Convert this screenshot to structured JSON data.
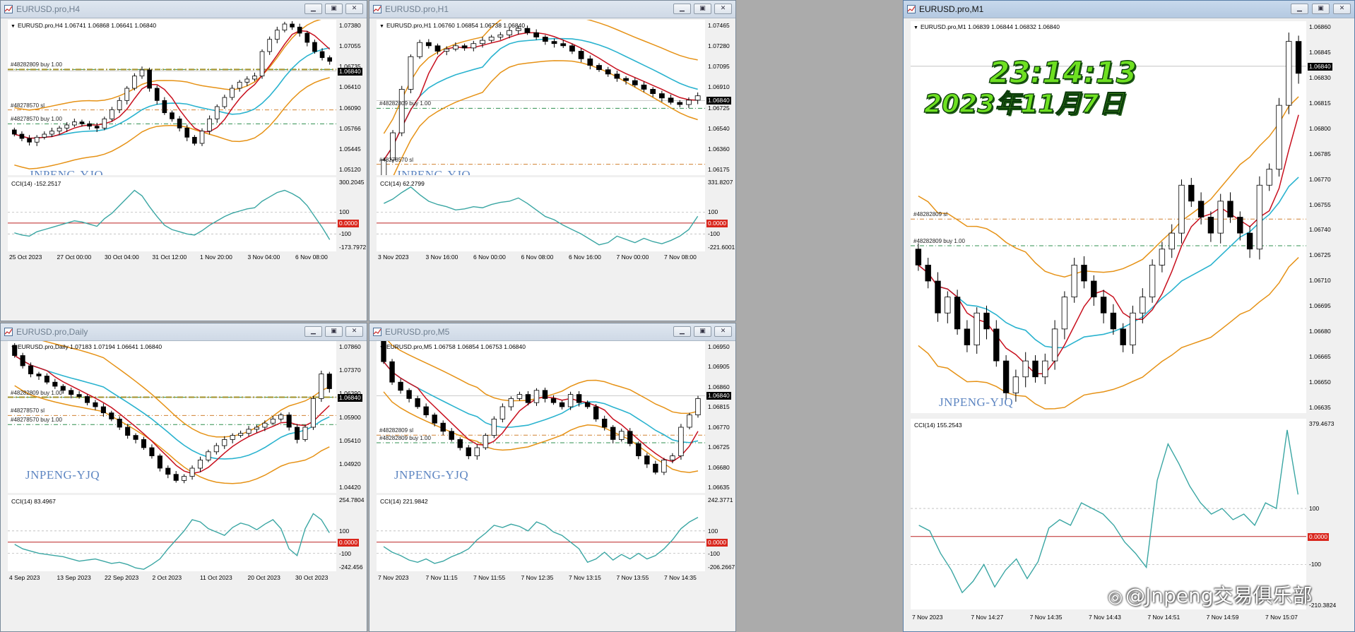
{
  "watermark": "JNPENG-YJQ",
  "colors": {
    "up": "#ffffff",
    "down": "#000000",
    "red_line": "#c8101e",
    "blue_line": "#2ab3cf",
    "band": "#e69216",
    "teal_cci": "#3aa6a3",
    "sl": "#d08030",
    "buy": "#2f8f4f",
    "orders": "#a09028"
  },
  "windows": [
    {
      "id": "h4",
      "title": "EURUSD.pro,H4",
      "active": false,
      "header": "EURUSD.pro,H4  1.06741 1.06868 1.06641 1.06840",
      "price_labels": [
        "1.07380",
        "1.07055",
        "1.06735",
        "1.06410",
        "1.06090",
        "1.05766",
        "1.05445",
        "1.05120"
      ],
      "current_price": "1.06840",
      "orders": [
        "#48282809 buy 1.00",
        "#48278570 sl",
        "#48278570 buy 1.00"
      ],
      "cci_label": "CCI(14) -152.2517",
      "cci_labels": [
        "300.2045",
        "100",
        "-100",
        "-173.7972"
      ],
      "cci_zero": "0.0000",
      "time_labels": [
        "25 Oct 2023",
        "27 Oct 00:00",
        "30 Oct 04:00",
        "31 Oct 12:00",
        "1 Nov 20:00",
        "3 Nov 04:00",
        "6 Nov 08:00"
      ]
    },
    {
      "id": "h1",
      "title": "EURUSD.pro,H1",
      "active": false,
      "header": "EURUSD.pro,H1  1.06760 1.06854 1.06738 1.06840",
      "price_labels": [
        "1.07465",
        "1.07280",
        "1.07095",
        "1.06910",
        "1.06725",
        "1.06540",
        "1.06360",
        "1.06175"
      ],
      "current_price": "1.06840",
      "orders": [
        "#48282809 buy 1.00",
        "#48278570 sl"
      ],
      "cci_label": "CCI(14) 62.2799",
      "cci_labels": [
        "331.8207",
        "100",
        "-100",
        "-221.6001"
      ],
      "cci_zero": "0.0000",
      "time_labels": [
        "3 Nov 2023",
        "3 Nov 16:00",
        "6 Nov 00:00",
        "6 Nov 08:00",
        "6 Nov 16:00",
        "7 Nov 00:00",
        "7 Nov 08:00"
      ]
    },
    {
      "id": "d1",
      "title": "EURUSD.pro,Daily",
      "active": false,
      "header": "EURUSD.pro,Daily  1.07183 1.07194 1.06641 1.06840",
      "price_labels": [
        "1.07860",
        "1.07370",
        "1.06390",
        "1.05900",
        "1.05410",
        "1.04920",
        "1.04420"
      ],
      "current_price": "1.06840",
      "orders": [
        "#48282809 buy 1.00",
        "#48278570 sl",
        "#48278570 buy 1.00"
      ],
      "cci_label": "CCI(14) 83.4967",
      "cci_labels": [
        "254.7804",
        "100",
        "-100",
        "-242.456"
      ],
      "cci_zero": "0.0000",
      "time_labels": [
        "4 Sep 2023",
        "13 Sep 2023",
        "22 Sep 2023",
        "2 Oct 2023",
        "11 Oct 2023",
        "20 Oct 2023",
        "30 Oct 2023"
      ]
    },
    {
      "id": "m5",
      "title": "EURUSD.pro,M5",
      "active": false,
      "header": "EURUSD.pro,M5  1.06758 1.06854 1.06753 1.06840",
      "price_labels": [
        "1.06950",
        "1.06905",
        "1.06860",
        "1.06815",
        "1.06770",
        "1.06725",
        "1.06680",
        "1.06635"
      ],
      "current_price": "1.06840",
      "orders": [
        "#48282809 sl",
        "#48282809 buy 1.00"
      ],
      "cci_label": "CCI(14) 221.9842",
      "cci_labels": [
        "242.3771",
        "100",
        "-100",
        "-206.2667"
      ],
      "cci_zero": "0.0000",
      "time_labels": [
        "7 Nov 2023",
        "7 Nov 11:15",
        "7 Nov 11:55",
        "7 Nov 12:35",
        "7 Nov 13:15",
        "7 Nov 13:55",
        "7 Nov 14:35"
      ]
    },
    {
      "id": "m1",
      "title": "EURUSD.pro,M1",
      "active": true,
      "header": "EURUSD.pro,M1  1.06839 1.06844 1.06832 1.06840",
      "price_labels": [
        "1.06860",
        "1.06845",
        "1.06830",
        "1.06815",
        "1.06800",
        "1.06785",
        "1.06770",
        "1.06755",
        "1.06740",
        "1.06725",
        "1.06710",
        "1.06695",
        "1.06680",
        "1.06665",
        "1.06650",
        "1.06635"
      ],
      "current_price": "1.06840",
      "orders": [
        "#48282809 sl",
        "#48282809 buy 1.00"
      ],
      "cci_label": "CCI(14) 155.2543",
      "cci_labels": [
        "379.4673",
        "100",
        "-100",
        "-210.3824"
      ],
      "cci_zero": "0.0000",
      "time_labels": [
        "7 Nov 2023",
        "7 Nov 14:27",
        "7 Nov 14:35",
        "7 Nov 14:43",
        "7 Nov 14:51",
        "7 Nov 14:59",
        "7 Nov 15:07"
      ]
    }
  ],
  "overlay": {
    "time": "23:14:13",
    "date": "2023年11月7日"
  },
  "brand_label": "@Jnpeng交易俱乐部",
  "brand_icon": "camera-icon",
  "window_buttons": {
    "minimize": "minimize-icon",
    "restore": "restore-icon",
    "close": "close-icon"
  },
  "chart_data": [
    {
      "type": "candlestick",
      "title": "EURUSD.pro,H4",
      "ylim": [
        1.0505,
        1.0745
      ],
      "close": [
        1.0565,
        1.0558,
        1.0552,
        1.056,
        1.0565,
        1.057,
        1.0575,
        1.058,
        1.0585,
        1.0582,
        1.0578,
        1.0575,
        1.059,
        1.0605,
        1.062,
        1.064,
        1.066,
        1.067,
        1.064,
        1.062,
        1.06,
        1.059,
        1.0575,
        1.056,
        1.055,
        1.057,
        1.059,
        1.061,
        1.0625,
        1.064,
        1.065,
        1.0655,
        1.066,
        1.07,
        1.072,
        1.0735,
        1.0745,
        1.074,
        1.073,
        1.0715,
        1.07,
        1.069,
        1.0684
      ],
      "cci": [
        -90,
        -110,
        -120,
        -80,
        -60,
        -40,
        -20,
        0,
        20,
        10,
        -10,
        -30,
        40,
        90,
        160,
        230,
        300,
        250,
        150,
        60,
        -20,
        -60,
        -80,
        -100,
        -110,
        -70,
        -20,
        20,
        60,
        90,
        110,
        130,
        140,
        200,
        240,
        280,
        300,
        270,
        230,
        160,
        60,
        -40,
        -152
      ]
    },
    {
      "type": "candlestick",
      "title": "EURUSD.pro,H1",
      "ylim": [
        1.0615,
        1.075
      ],
      "close": [
        1.0625,
        1.065,
        1.069,
        1.072,
        1.0733,
        1.073,
        1.0725,
        1.0727,
        1.073,
        1.0728,
        1.0732,
        1.0735,
        1.0738,
        1.074,
        1.0744,
        1.0746,
        1.0742,
        1.0738,
        1.0734,
        1.0732,
        1.073,
        1.0725,
        1.0718,
        1.0712,
        1.0708,
        1.0704,
        1.07,
        1.0698,
        1.0694,
        1.069,
        1.0686,
        1.0682,
        1.0678,
        1.0676,
        1.068,
        1.0684
      ],
      "cci": [
        180,
        220,
        280,
        331,
        260,
        200,
        170,
        150,
        120,
        130,
        150,
        140,
        170,
        190,
        200,
        230,
        180,
        120,
        60,
        30,
        -20,
        -60,
        -100,
        -150,
        -200,
        -180,
        -120,
        -150,
        -180,
        -140,
        -170,
        -190,
        -160,
        -120,
        -60,
        62
      ]
    },
    {
      "type": "candlestick",
      "title": "EURUSD.pro,Daily",
      "ylim": [
        1.044,
        1.079
      ],
      "close": [
        1.0765,
        1.074,
        1.072,
        1.0715,
        1.07,
        1.069,
        1.068,
        1.067,
        1.0665,
        1.065,
        1.064,
        1.0625,
        1.061,
        1.059,
        1.057,
        1.056,
        1.054,
        1.052,
        1.049,
        1.0475,
        1.046,
        1.047,
        1.049,
        1.051,
        1.053,
        1.0545,
        1.056,
        1.057,
        1.0575,
        1.0585,
        1.059,
        1.06,
        1.061,
        1.062,
        1.059,
        1.056,
        1.059,
        1.066,
        1.072,
        1.0684
      ],
      "cci": [
        -20,
        -60,
        -80,
        -100,
        -110,
        -120,
        -130,
        -150,
        -170,
        -160,
        -150,
        -170,
        -190,
        -180,
        -200,
        -230,
        -242,
        -200,
        -150,
        -60,
        20,
        100,
        200,
        180,
        120,
        90,
        60,
        130,
        170,
        150,
        110,
        160,
        200,
        120,
        -60,
        -120,
        120,
        254,
        200,
        83
      ]
    },
    {
      "type": "candlestick",
      "title": "EURUSD.pro,M5",
      "ylim": [
        1.0662,
        1.0697
      ],
      "close": [
        1.0693,
        1.0688,
        1.0686,
        1.0684,
        1.0682,
        1.068,
        1.0678,
        1.0676,
        1.0674,
        1.0672,
        1.067,
        1.0672,
        1.0675,
        1.0679,
        1.0682,
        1.0684,
        1.0685,
        1.0683,
        1.0686,
        1.0684,
        1.0683,
        1.0682,
        1.0685,
        1.0683,
        1.0682,
        1.0679,
        1.0677,
        1.0674,
        1.0676,
        1.0673,
        1.067,
        1.0668,
        1.0666,
        1.0669,
        1.067,
        1.0677,
        1.068,
        1.0684
      ],
      "cci": [
        -40,
        -90,
        -120,
        -160,
        -180,
        -150,
        -190,
        -170,
        -130,
        -100,
        -60,
        20,
        80,
        150,
        130,
        160,
        140,
        100,
        180,
        150,
        90,
        60,
        0,
        -60,
        -180,
        -150,
        -90,
        -160,
        -110,
        -150,
        -100,
        -150,
        -120,
        -60,
        20,
        120,
        180,
        221
      ]
    },
    {
      "type": "candlestick",
      "title": "EURUSD.pro,M1",
      "ylim": [
        1.0663,
        1.0687
      ],
      "close": [
        1.0672,
        1.0671,
        1.0669,
        1.067,
        1.0668,
        1.0667,
        1.0669,
        1.0668,
        1.0666,
        1.0664,
        1.0665,
        1.0666,
        1.0665,
        1.0666,
        1.0668,
        1.067,
        1.0672,
        1.0671,
        1.067,
        1.0669,
        1.0668,
        1.0667,
        1.0669,
        1.067,
        1.0672,
        1.0673,
        1.0674,
        1.0677,
        1.0676,
        1.0675,
        1.0674,
        1.0676,
        1.0675,
        1.0674,
        1.0673,
        1.0677,
        1.0678,
        1.0682,
        1.0686,
        1.0684
      ],
      "cci": [
        40,
        20,
        -60,
        -120,
        -200,
        -160,
        -100,
        -180,
        -120,
        -80,
        -150,
        -90,
        30,
        60,
        40,
        120,
        100,
        80,
        40,
        -20,
        -60,
        -110,
        200,
        330,
        260,
        180,
        120,
        80,
        100,
        60,
        80,
        40,
        120,
        100,
        380,
        150
      ]
    }
  ]
}
